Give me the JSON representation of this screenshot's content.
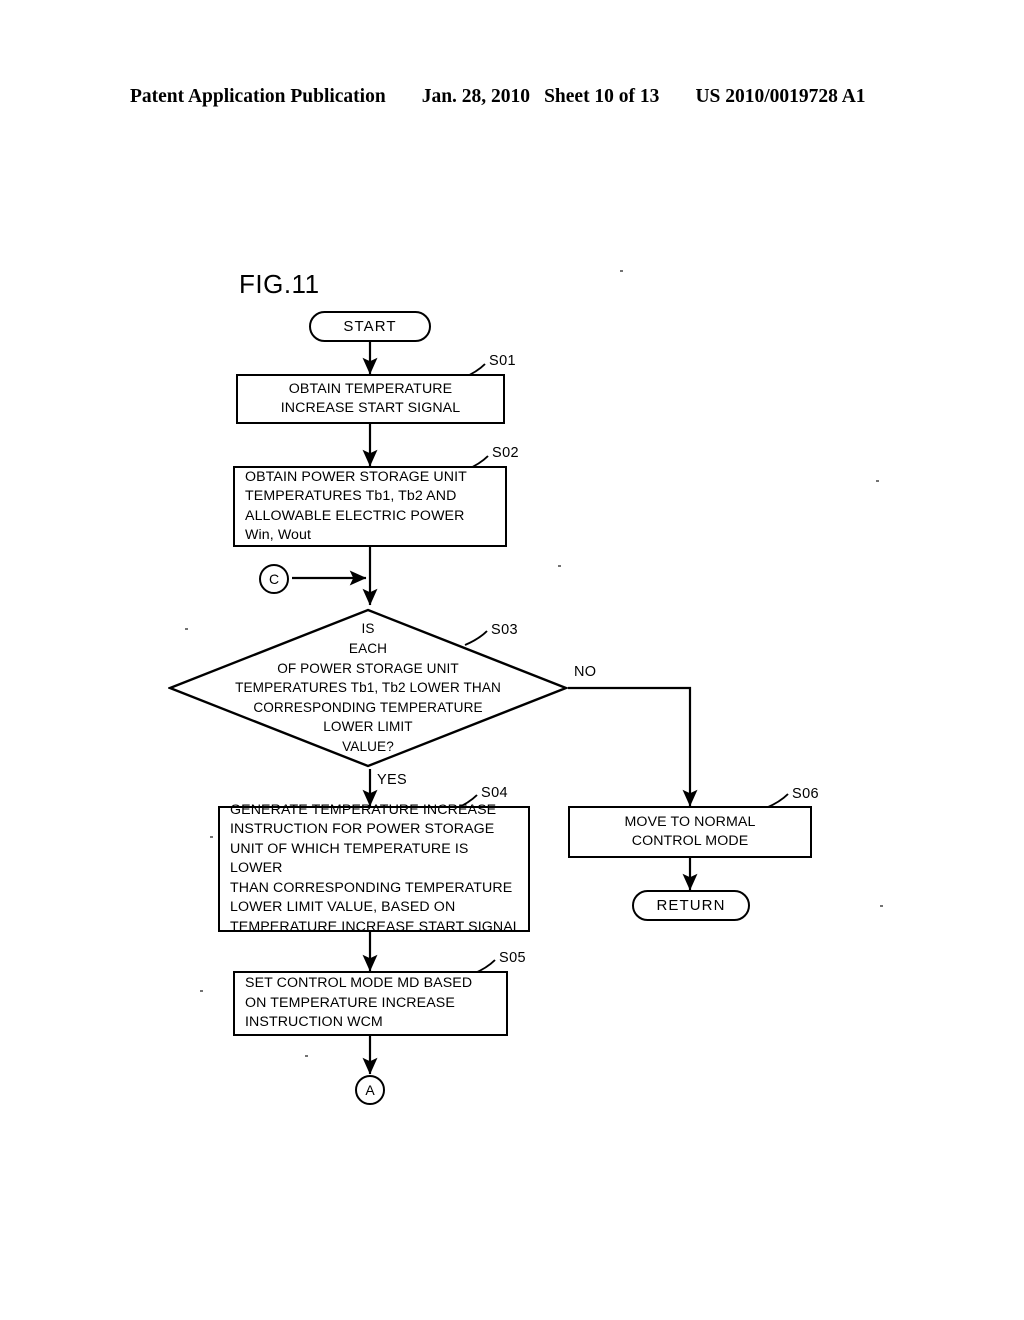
{
  "header": {
    "publication": "Patent Application Publication",
    "date": "Jan. 28, 2010",
    "sheet": "Sheet 10 of 13",
    "number": "US 2010/0019728 A1"
  },
  "figure": {
    "label": "FIG.11"
  },
  "flowchart": {
    "start": {
      "label": "START",
      "type": "terminal"
    },
    "s01": {
      "ref": "S01",
      "text": "OBTAIN TEMPERATURE\nINCREASE START SIGNAL",
      "type": "process"
    },
    "s02": {
      "ref": "S02",
      "text": "OBTAIN POWER STORAGE UNIT\nTEMPERATURES Tb1, Tb2 AND\nALLOWABLE ELECTRIC POWER\nWin, Wout",
      "type": "process"
    },
    "connector_c": {
      "label": "C",
      "type": "connector"
    },
    "s03": {
      "ref": "S03",
      "text": "IS\nEACH\nOF POWER STORAGE UNIT\nTEMPERATURES Tb1, Tb2 LOWER THAN\nCORRESPONDING TEMPERATURE\nLOWER LIMIT\nVALUE?",
      "type": "decision",
      "yes_label": "YES",
      "no_label": "NO"
    },
    "s04": {
      "ref": "S04",
      "text": "GENERATE TEMPERATURE INCREASE\nINSTRUCTION FOR POWER STORAGE\nUNIT OF WHICH TEMPERATURE IS LOWER\nTHAN CORRESPONDING TEMPERATURE\nLOWER LIMIT VALUE, BASED ON\nTEMPERATURE INCREASE START SIGNAL",
      "type": "process"
    },
    "s05": {
      "ref": "S05",
      "text": "SET CONTROL MODE MD BASED\nON TEMPERATURE INCREASE\nINSTRUCTION WCM",
      "type": "process"
    },
    "s06": {
      "ref": "S06",
      "text": "MOVE TO NORMAL\nCONTROL MODE",
      "type": "process"
    },
    "return": {
      "label": "RETURN",
      "type": "terminal"
    },
    "connector_a": {
      "label": "A",
      "type": "connector"
    }
  },
  "colors": {
    "ink": "#000000",
    "paper": "#ffffff"
  }
}
